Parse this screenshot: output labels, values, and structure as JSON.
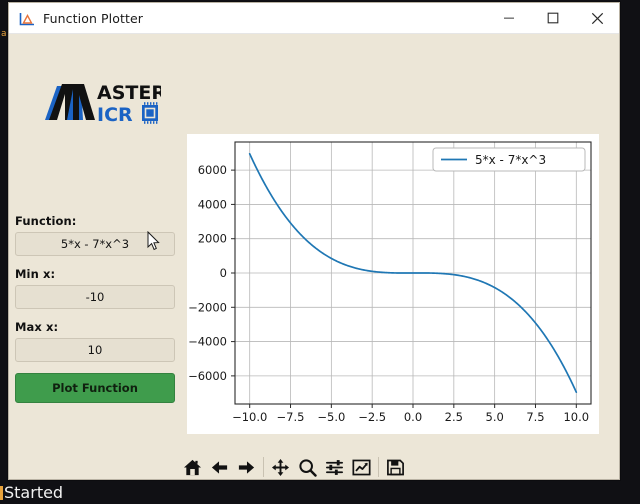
{
  "window": {
    "title": "Function Plotter",
    "icon": "chart-icon",
    "controls": {
      "minimize": "minimize-icon",
      "maximize": "maximize-icon",
      "close": "close-icon"
    }
  },
  "brand": {
    "name_top": "ASTER",
    "name_bottom": "ICR",
    "mark_letter": "M",
    "chip_icon": "microchip-icon",
    "primary_color": "#1b63c4",
    "dark_color": "#111111"
  },
  "form": {
    "function": {
      "label": "Function:",
      "value": "5*x - 7*x^3",
      "placeholder": "5*x - 7*x^3"
    },
    "min_x": {
      "label": "Min x:",
      "value": "-10",
      "placeholder": "-10"
    },
    "max_x": {
      "label": "Max x:",
      "value": "10",
      "placeholder": "10"
    },
    "submit": {
      "label": "Plot Function",
      "color": "#3f9c4c"
    }
  },
  "toolbar": {
    "buttons": [
      {
        "name": "home-icon",
        "tooltip": "Home"
      },
      {
        "name": "arrow-left-icon",
        "tooltip": "Back"
      },
      {
        "name": "arrow-right-icon",
        "tooltip": "Forward"
      },
      {
        "name": "move-icon",
        "tooltip": "Pan"
      },
      {
        "name": "magnifier-icon",
        "tooltip": "Zoom to rectangle"
      },
      {
        "name": "sliders-icon",
        "tooltip": "Configure subplots"
      },
      {
        "name": "line-chart-icon",
        "tooltip": "Edit axis"
      },
      {
        "name": "floppy-disk-icon",
        "tooltip": "Save the figure"
      }
    ]
  },
  "terminal": {
    "status_line": "Started",
    "side_text": "a s"
  },
  "chart_data": {
    "type": "line",
    "title": "",
    "xlabel": "",
    "ylabel": "",
    "xlim": [
      -10.9,
      10.9
    ],
    "ylim": [
      -7640,
      7640
    ],
    "grid": true,
    "legend_position": "upper right",
    "line_color": "#1f77b4",
    "xticks": [
      "-10.0",
      "-7.5",
      "-5.0",
      "-2.5",
      "0.0",
      "2.5",
      "5.0",
      "7.5",
      "10.0"
    ],
    "xtick_values": [
      -10,
      -7.5,
      -5,
      -2.5,
      0,
      2.5,
      5,
      7.5,
      10
    ],
    "yticks": [
      "6000",
      "4000",
      "2000",
      "0",
      "-2000",
      "-4000",
      "-6000"
    ],
    "ytick_values": [
      6000,
      4000,
      2000,
      0,
      -2000,
      -4000,
      -6000
    ],
    "series": [
      {
        "name": "5*x - 7*x^3",
        "expression": "5*x - 7*x^3",
        "x": [
          -10,
          -9.5,
          -9,
          -8.5,
          -8,
          -7.5,
          -7,
          -6.5,
          -6,
          -5.5,
          -5,
          -4.5,
          -4,
          -3.5,
          -3,
          -2.5,
          -2,
          -1.5,
          -1,
          -0.5,
          0,
          0.5,
          1,
          1.5,
          2,
          2.5,
          3,
          3.5,
          4,
          4.5,
          5,
          5.5,
          6,
          6.5,
          7,
          7.5,
          8,
          8.5,
          9,
          9.5,
          10
        ],
        "y": [
          6950,
          5953.625,
          5058,
          4255.375,
          3544,
          2917.125,
          2366,
          1888.875,
          1482,
          1137.125,
          850,
          616.875,
          432,
          290.125,
          186,
          114.375,
          66,
          35.625,
          2,
          0.375,
          0,
          1.625,
          -2,
          -14.625,
          -46,
          -105.625,
          -174,
          -290.875,
          -452,
          -661.125,
          -925,
          -1243.875,
          -1482,
          -2090.875,
          -2590,
          -3154.125,
          -3544,
          -4277.375,
          -5058,
          -5953.625,
          -6950
        ]
      }
    ]
  }
}
